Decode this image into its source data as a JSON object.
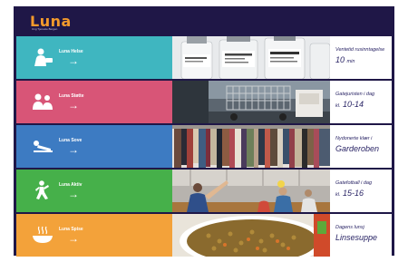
{
  "app": {
    "logo": "Luna",
    "tagline": "Ung Tjeneste Bergen"
  },
  "rows": [
    {
      "tile_label": "Luna Helse",
      "arrow": "→",
      "tile_color": "#3fb6c0",
      "icon": "doctor-icon",
      "photo": "medicine-bottles-photo",
      "info_caption": "Ventetid rusinntagelse",
      "info_prefix": "",
      "info_value": "10",
      "info_suffix": "min"
    },
    {
      "tile_label": "Luna Støtte",
      "arrow": "→",
      "tile_color": "#d85577",
      "icon": "support-people-icon",
      "photo": "shopping-cart-photo",
      "info_caption": "Gatejuristen i dag",
      "info_prefix": "kl.",
      "info_value": "10-14",
      "info_suffix": ""
    },
    {
      "tile_label": "Luna Sove",
      "arrow": "→",
      "tile_color": "#3d7bc2",
      "icon": "sleep-icon",
      "photo": "clothes-rack-photo",
      "info_caption": "Nydonerte klær i",
      "info_prefix": "",
      "info_value": "Garderoben",
      "info_suffix": ""
    },
    {
      "tile_label": "Luna Aktiv",
      "arrow": "→",
      "tile_color": "#46b04a",
      "icon": "active-person-icon",
      "photo": "gym-people-photo",
      "info_caption": "Gatefotball i dag",
      "info_prefix": "kl.",
      "info_value": "15-16",
      "info_suffix": ""
    },
    {
      "tile_label": "Luna Spise",
      "arrow": "→",
      "tile_color": "#f3a23a",
      "icon": "food-bowl-icon",
      "photo": "lentil-soup-photo",
      "info_caption": "Dagens lunsj",
      "info_prefix": "",
      "info_value": "Linsesuppe",
      "info_suffix": ""
    }
  ]
}
